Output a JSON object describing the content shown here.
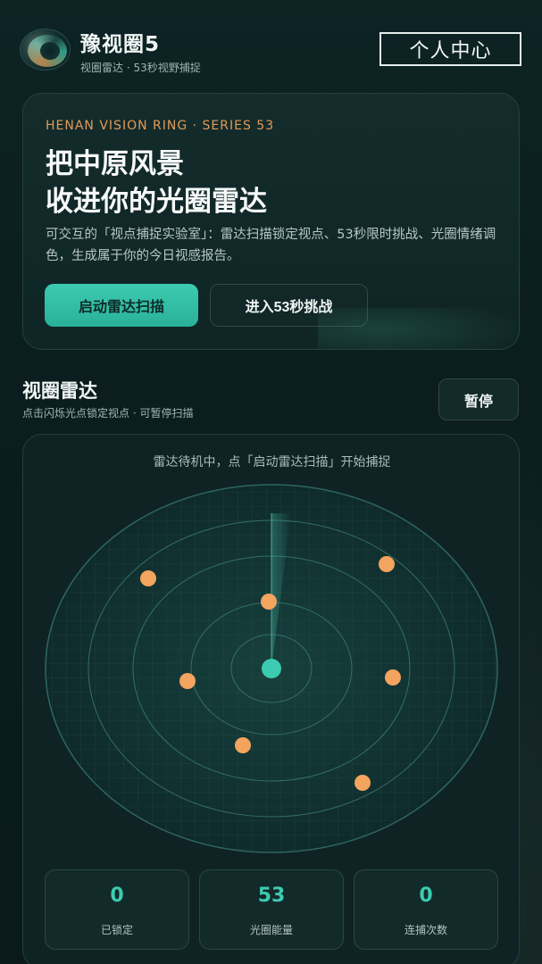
{
  "header": {
    "brand": "豫视圈5",
    "subtitle": "视圈雷达 · 53秒视野捕捉",
    "profile_label": "个人中心"
  },
  "hero": {
    "kicker": "HENAN VISION RING · SERIES 53",
    "title_line1": "把中原风景",
    "title_line2": "收进你的光圈雷达",
    "description": "可交互的「视点捕捉实验室」：雷达扫描锁定视点、53秒限时挑战、光圈情绪调色，生成属于你的今日视感报告。",
    "primary_button": "启动雷达扫描",
    "secondary_button": "进入53秒挑战"
  },
  "radar_section": {
    "title": "视圈雷达",
    "subtitle": "点击闪烁光点锁定视点 · 可暂停扫描",
    "pause_button": "暂停",
    "status": "雷达待机中，点「启动雷达扫描」开始捕捉"
  },
  "stats": [
    {
      "value": "0",
      "label": "已锁定"
    },
    {
      "value": "53",
      "label": "光圈能量"
    },
    {
      "value": "0",
      "label": "连捕次数"
    }
  ],
  "colors": {
    "accent": "#3ccbb1",
    "orange": "#f3a45e",
    "kicker": "#e39a57"
  }
}
